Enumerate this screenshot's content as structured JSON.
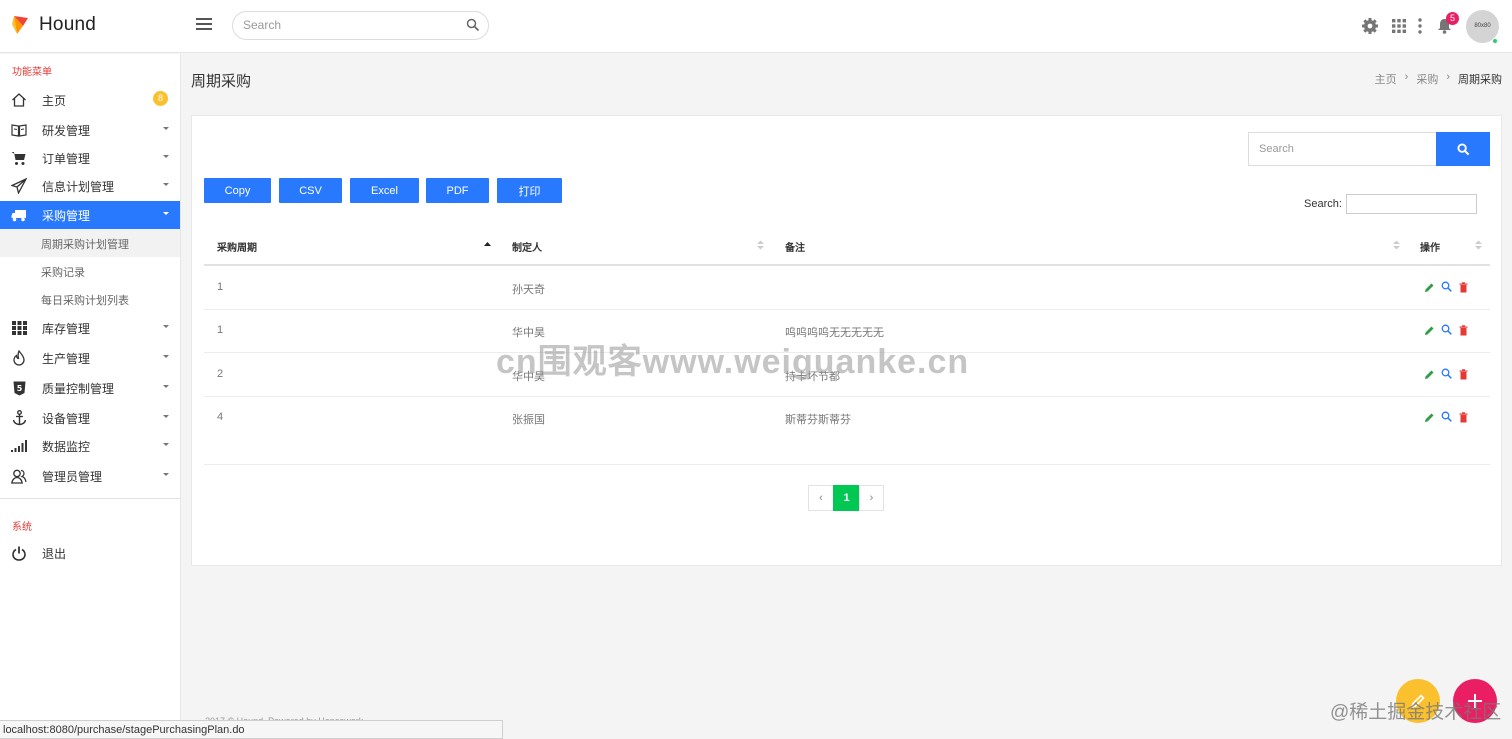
{
  "brand": {
    "name": "Hound"
  },
  "topbar": {
    "search_placeholder": "Search",
    "notification_count": "5",
    "avatar_text": "80x80"
  },
  "sidebar": {
    "section_main": "功能菜单",
    "section_system": "系统",
    "home_badge": "8",
    "items": [
      {
        "label": "主页",
        "icon": "home-icon"
      },
      {
        "label": "研发管理",
        "icon": "book-icon"
      },
      {
        "label": "订单管理",
        "icon": "cart-icon"
      },
      {
        "label": "信息计划管理",
        "icon": "send-icon"
      },
      {
        "label": "采购管理",
        "icon": "truck-icon"
      },
      {
        "label": "库存管理",
        "icon": "grid-icon"
      },
      {
        "label": "生产管理",
        "icon": "fire-icon"
      },
      {
        "label": "质量控制管理",
        "icon": "shield-icon"
      },
      {
        "label": "设备管理",
        "icon": "anchor-icon"
      },
      {
        "label": "数据监控",
        "icon": "signal-icon"
      },
      {
        "label": "管理员管理",
        "icon": "users-icon"
      }
    ],
    "sub_items": [
      {
        "label": "周期采购计划管理"
      },
      {
        "label": "采购记录"
      },
      {
        "label": "每日采购计划列表"
      }
    ],
    "logout": {
      "label": "退出",
      "icon": "power-icon"
    }
  },
  "page": {
    "title": "周期采购",
    "breadcrumb": [
      "主页",
      "采购",
      "周期采购"
    ]
  },
  "card": {
    "search_placeholder": "Search",
    "buttons": [
      "Copy",
      "CSV",
      "Excel",
      "PDF",
      "打印"
    ],
    "dt_search_label": "Search:"
  },
  "table": {
    "columns": [
      "采购周期",
      "制定人",
      "备注",
      "操作"
    ],
    "rows": [
      {
        "period": "1",
        "maker": "孙天奇",
        "note": ""
      },
      {
        "period": "1",
        "maker": "华中昊",
        "note": "呜呜呜呜无无无无无"
      },
      {
        "period": "2",
        "maker": "华中昊",
        "note": "持卡坏节都"
      },
      {
        "period": "4",
        "maker": "张振国",
        "note": "斯蒂芬斯蒂芬"
      }
    ]
  },
  "pagination": {
    "prev": "‹",
    "current": "1",
    "next": "›"
  },
  "footer": {
    "text": "2017 © Hound. Powered by Hencework"
  },
  "status_url": "localhost:8080/purchase/stagePurchasingPlan.do",
  "watermarks": {
    "center": "cn围观客www.weiguanke.cn",
    "corner": "@稀土掘金技术社区"
  },
  "colors": {
    "primary": "#2979ff",
    "success": "#00c853",
    "danger": "#e53935",
    "badge": "#fbc02d"
  }
}
